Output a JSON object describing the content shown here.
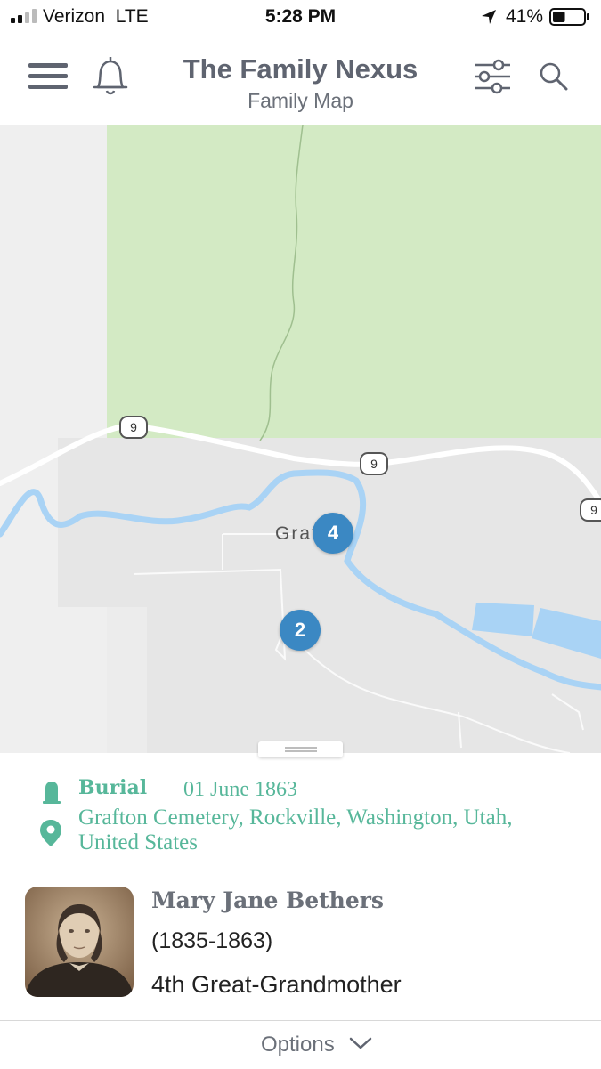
{
  "status_bar": {
    "carrier": "Verizon",
    "network": "LTE",
    "time": "5:28 PM",
    "battery_percent": "41%",
    "battery_level": 0.41
  },
  "header": {
    "title": "The Family Nexus",
    "subtitle": "Family Map"
  },
  "map": {
    "town_label": "Grafton",
    "road_number": "9",
    "clusters": [
      {
        "count": "4"
      },
      {
        "count": "2"
      }
    ],
    "colors": {
      "land": "#ececec",
      "park": "#d3eac4",
      "water": "#a9d3f5",
      "road": "#ffffff",
      "cluster": "#3b88c3"
    }
  },
  "event": {
    "type": "Burial",
    "date": "01 June 1863",
    "place": "Grafton Cemetery, Rockville, Washington, Utah, United States",
    "accent_color": "#57b79a"
  },
  "person": {
    "name": "Mary Jane Bethers",
    "years": "(1835-1863)",
    "relation": "4th Great-Grandmother"
  },
  "options": {
    "label": "Options"
  }
}
